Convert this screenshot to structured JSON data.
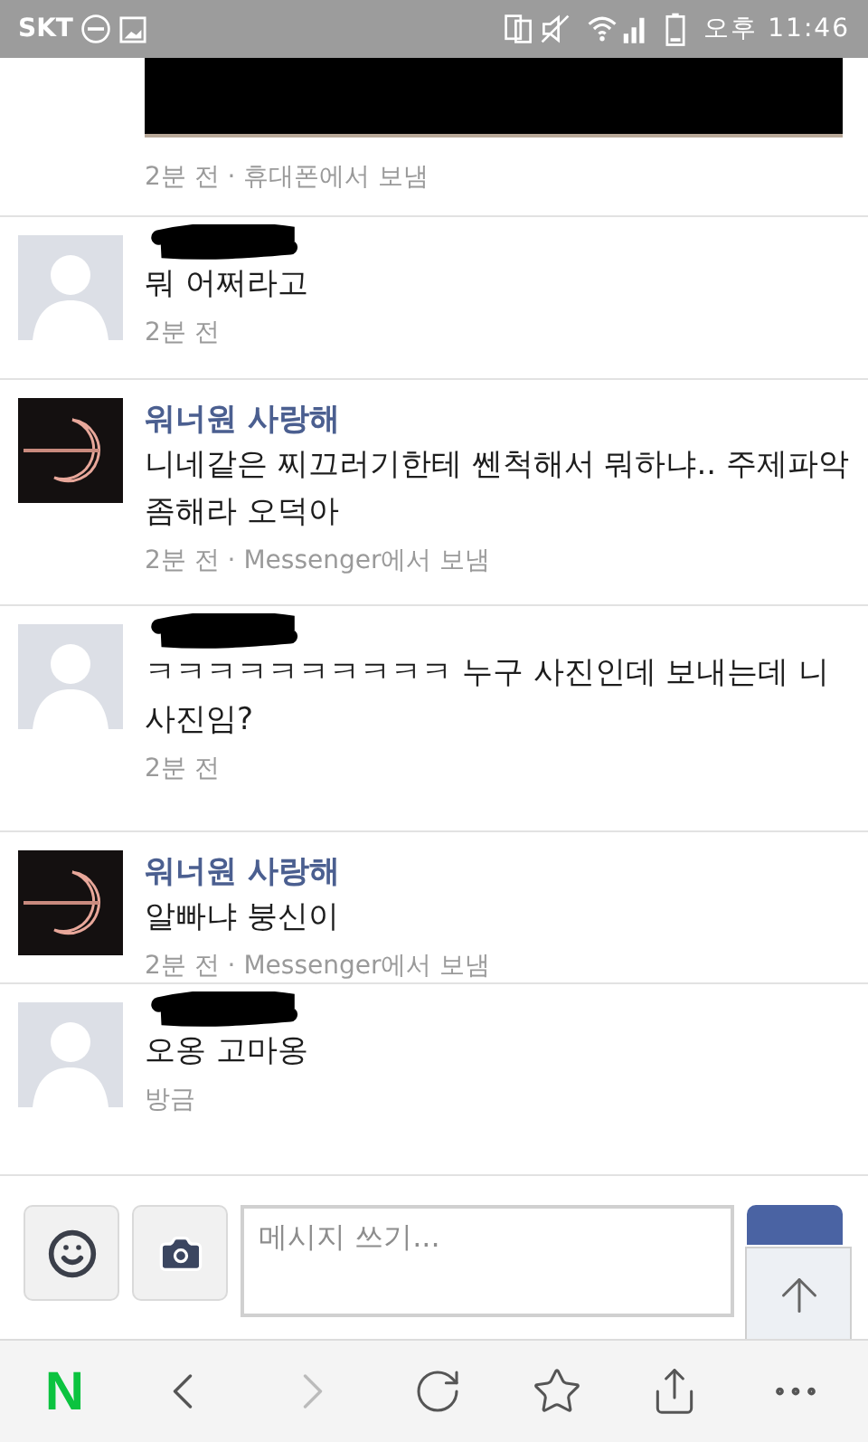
{
  "status_bar": {
    "carrier": "SKT",
    "time": "오후 11:46"
  },
  "top_message": {
    "meta": "2분 전 · 휴대폰에서 보냄"
  },
  "messages": [
    {
      "kind": "default",
      "name_redacted": true,
      "text": "뭐 어쩌라고",
      "meta": "2분 전"
    },
    {
      "kind": "logo",
      "name_redacted": false,
      "name": "워너원 사랑해",
      "text": "니네같은 찌끄러기한테 쎈척해서 뭐하냐.. 주제파악 좀해라 오덕아",
      "meta": "2분 전 · Messenger에서 보냄"
    },
    {
      "kind": "default",
      "name_redacted": true,
      "text": "ㅋㅋㅋㅋㅋㅋㅋㅋㅋㅋ 누구 사진인데 보내는데 니사진임?",
      "meta": "2분 전"
    },
    {
      "kind": "logo",
      "name_redacted": false,
      "name": "워너원 사랑해",
      "text": "알빠냐 붕신이",
      "meta": "2분 전 · Messenger에서 보냄"
    },
    {
      "kind": "default",
      "name_redacted": true,
      "text": "오옹 고마옹",
      "meta": "방금"
    }
  ],
  "composer": {
    "placeholder": "메시지 쓰기..."
  },
  "browser_bar": {
    "logo": "N"
  }
}
